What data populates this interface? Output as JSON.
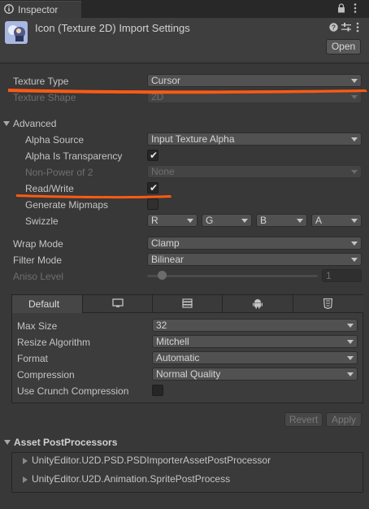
{
  "window": {
    "tab_label": "Inspector"
  },
  "header": {
    "title": "Icon (Texture 2D) Import Settings",
    "open_label": "Open"
  },
  "texture": {
    "type_label": "Texture Type",
    "type_value": "Cursor",
    "shape_label": "Texture Shape",
    "shape_value": "2D"
  },
  "advanced": {
    "label": "Advanced",
    "alpha_source_label": "Alpha Source",
    "alpha_source_value": "Input Texture Alpha",
    "alpha_transparency_label": "Alpha Is Transparency",
    "alpha_transparency_checked": true,
    "npot_label": "Non-Power of 2",
    "npot_value": "None",
    "read_write_label": "Read/Write",
    "read_write_checked": true,
    "mipmaps_label": "Generate Mipmaps",
    "mipmaps_checked": false,
    "swizzle_label": "Swizzle",
    "swizzle_values": [
      "R",
      "G",
      "B",
      "A"
    ]
  },
  "wrap": {
    "label": "Wrap Mode",
    "value": "Clamp"
  },
  "filter": {
    "label": "Filter Mode",
    "value": "Bilinear"
  },
  "aniso": {
    "label": "Aniso Level",
    "value": "1",
    "fraction": 0.0
  },
  "platform": {
    "tabs": [
      "Default"
    ],
    "max_size_label": "Max Size",
    "max_size_value": "32",
    "resize_label": "Resize Algorithm",
    "resize_value": "Mitchell",
    "format_label": "Format",
    "format_value": "Automatic",
    "compression_label": "Compression",
    "compression_value": "Normal Quality",
    "crunch_label": "Use Crunch Compression",
    "crunch_checked": false
  },
  "actions": {
    "revert_label": "Revert",
    "apply_label": "Apply"
  },
  "postprocessors": {
    "label": "Asset PostProcessors",
    "items": [
      "UnityEditor.U2D.PSD.PSDImporterAssetPostProcessor",
      "UnityEditor.U2D.Animation.SpritePostProcess"
    ]
  },
  "colors": {
    "background": "#383838",
    "annotation": "#ff5a14",
    "text": "#c4c4c4"
  }
}
